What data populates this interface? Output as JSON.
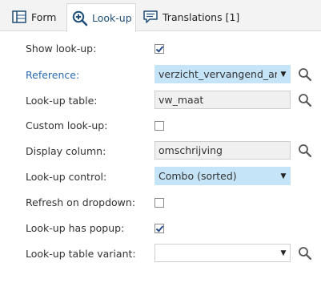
{
  "tabs": [
    {
      "label": "Form",
      "icon": "form-grid-icon"
    },
    {
      "label": "Look-up",
      "icon": "lookup-magnifier-icon",
      "active": true
    },
    {
      "label": "Translations [1]",
      "icon": "translations-icon"
    }
  ],
  "rows": {
    "show_lookup": {
      "label": "Show look-up:",
      "checked": true
    },
    "reference": {
      "label": "Reference:",
      "value": "verzicht_vervangend_artikel"
    },
    "lookup_table": {
      "label": "Look-up table:",
      "value": "vw_maat"
    },
    "custom_lookup": {
      "label": "Custom look-up:",
      "checked": false
    },
    "display_column": {
      "label": "Display column:",
      "value": "omschrijving"
    },
    "lookup_control": {
      "label": "Look-up control:",
      "value": "Combo (sorted)"
    },
    "refresh_on_dropdown": {
      "label": "Refresh on dropdown:",
      "checked": false
    },
    "lookup_has_popup": {
      "label": "Look-up has popup:",
      "checked": true
    },
    "lookup_table_variant": {
      "label": "Look-up table variant:",
      "value": ""
    }
  },
  "colors": {
    "accent_blue": "#2a6ab0",
    "selection_blue": "#1e6fd9",
    "highlight_field": "#c5e4f8"
  }
}
